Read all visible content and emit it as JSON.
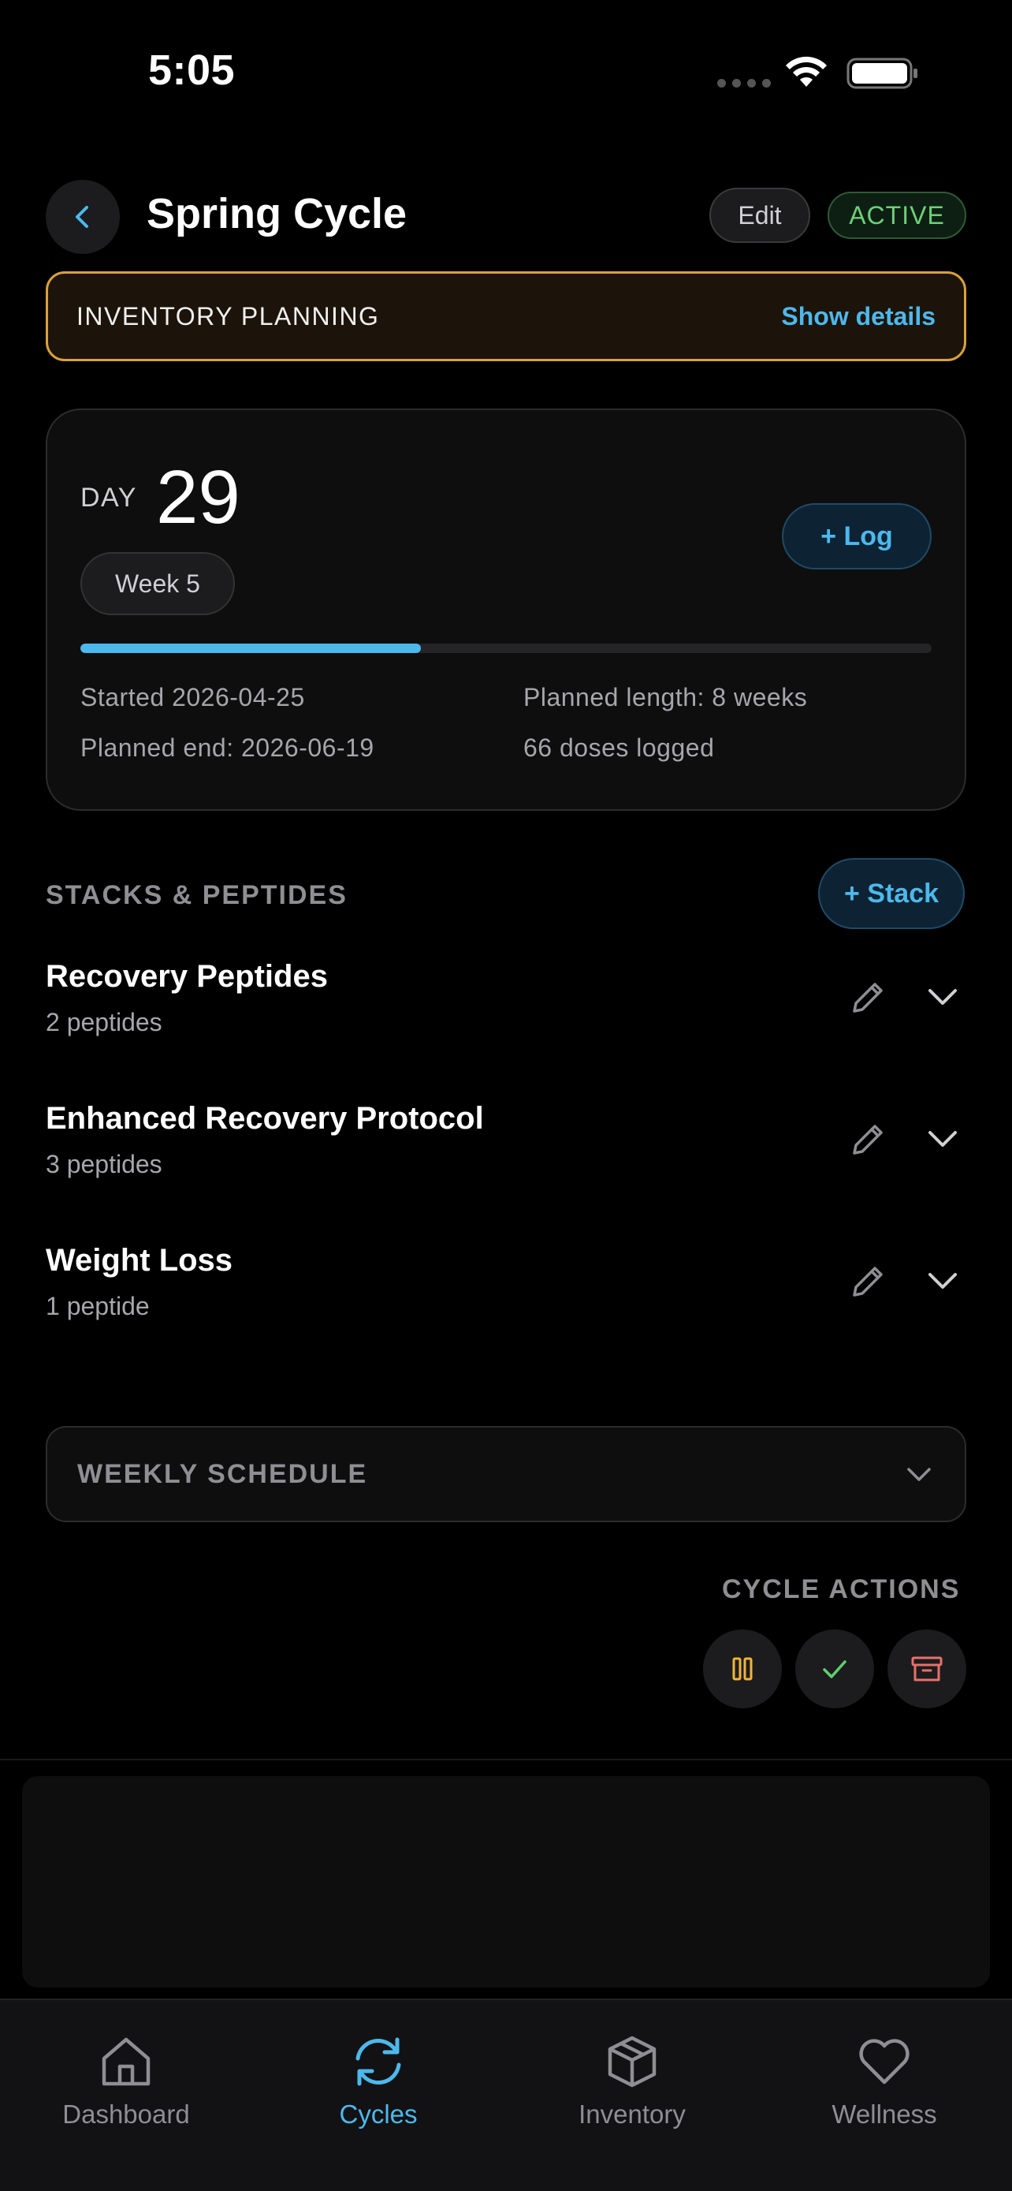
{
  "status_bar": {
    "time": "5:05"
  },
  "header": {
    "title": "Spring Cycle",
    "edit_label": "Edit",
    "status_badge": "ACTIVE"
  },
  "inventory_banner": {
    "title": "INVENTORY PLANNING",
    "link": "Show details"
  },
  "day_card": {
    "day_label": "DAY",
    "day_number": "29",
    "week_label": "Week 5",
    "log_label": "+ Log",
    "progress_fraction": 0.4,
    "started": "Started 2026-04-25",
    "planned_end": "Planned end: 2026-06-19",
    "planned_length": "Planned length: 8 weeks",
    "doses_logged": "66 doses logged"
  },
  "stacks": {
    "section_title": "STACKS & PEPTIDES",
    "add_label": "+ Stack",
    "items": [
      {
        "name": "Recovery Peptides",
        "count": "2 peptides"
      },
      {
        "name": "Enhanced Recovery Protocol",
        "count": "3 peptides"
      },
      {
        "name": "Weight Loss",
        "count": "1 peptide"
      }
    ]
  },
  "weekly_schedule": {
    "title": "WEEKLY SCHEDULE"
  },
  "cycle_actions": {
    "title": "CYCLE ACTIONS",
    "buttons": [
      {
        "icon": "pause-icon",
        "color": "#f0b43c"
      },
      {
        "icon": "check-icon",
        "color": "#5fcf6e"
      },
      {
        "icon": "archive-icon",
        "color": "#e8706a"
      }
    ]
  },
  "tab_bar": {
    "tabs": [
      {
        "label": "Dashboard",
        "icon": "home-icon",
        "active": false
      },
      {
        "label": "Cycles",
        "icon": "refresh-icon",
        "active": true
      },
      {
        "label": "Inventory",
        "icon": "box-icon",
        "active": false
      },
      {
        "label": "Wellness",
        "icon": "heart-icon",
        "active": false
      }
    ]
  },
  "colors": {
    "accent": "#4db8ec",
    "active_green": "#6fcf7a",
    "warning": "#d9a13b"
  }
}
